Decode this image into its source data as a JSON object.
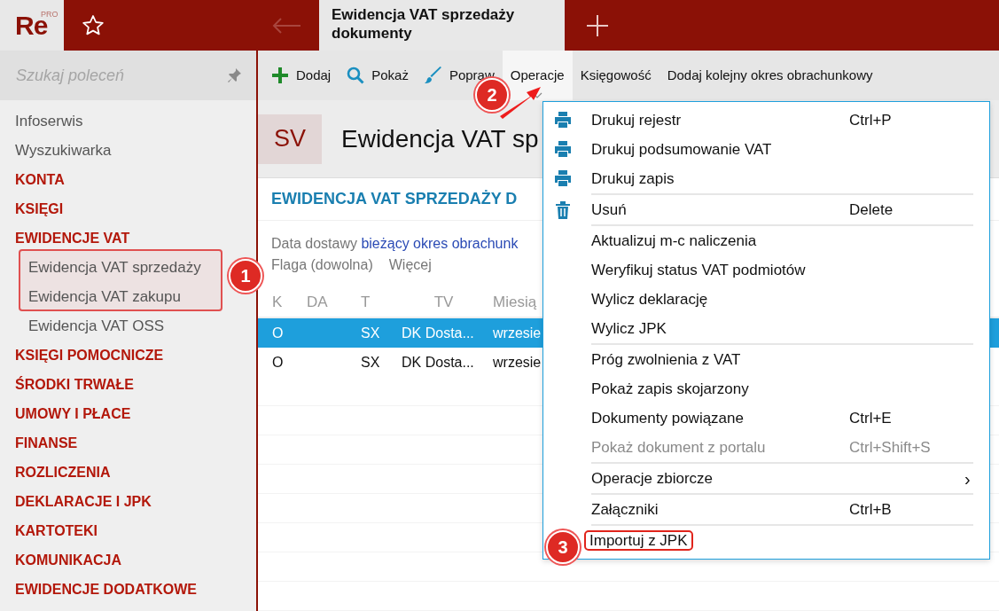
{
  "app": {
    "logo": "Re",
    "logo_badge": "PRO"
  },
  "tabs": [
    {
      "label": "Ewidencja VAT sprzedaży dokumenty",
      "selected": true
    }
  ],
  "sidebar": {
    "search": {
      "placeholder": "Szukaj poleceń"
    },
    "items": [
      {
        "label": "Infoserwis",
        "kind": "link"
      },
      {
        "label": "Wyszukiwarka",
        "kind": "link"
      },
      {
        "label": "KONTA",
        "kind": "section"
      },
      {
        "label": "KSIĘGI",
        "kind": "section"
      },
      {
        "label": "EWIDENCJE VAT",
        "kind": "section"
      },
      {
        "label": "Ewidencja VAT sprzedaży",
        "kind": "sub"
      },
      {
        "label": "Ewidencja VAT zakupu",
        "kind": "sub"
      },
      {
        "label": "Ewidencja VAT OSS",
        "kind": "sub"
      },
      {
        "label": "KSIĘGI POMOCNICZE",
        "kind": "section"
      },
      {
        "label": "ŚRODKI TRWAŁE",
        "kind": "section"
      },
      {
        "label": "UMOWY I PŁACE",
        "kind": "section"
      },
      {
        "label": "FINANSE",
        "kind": "section"
      },
      {
        "label": "ROZLICZENIA",
        "kind": "section"
      },
      {
        "label": "DEKLARACJE I JPK",
        "kind": "section"
      },
      {
        "label": "KARTOTEKI",
        "kind": "section"
      },
      {
        "label": "KOMUNIKACJA",
        "kind": "section"
      },
      {
        "label": "EWIDENCJE DODATKOWE",
        "kind": "section"
      }
    ]
  },
  "toolbar": [
    {
      "label": "Dodaj",
      "kind": "add",
      "selected": false
    },
    {
      "label": "Pokaż",
      "kind": "search",
      "selected": false
    },
    {
      "label": "Popraw",
      "kind": "edit",
      "selected": false
    },
    {
      "label": "Operacje",
      "kind": "plain",
      "selected": true
    },
    {
      "label": "Księgowość",
      "kind": "plain",
      "selected": false
    },
    {
      "label": "Dodaj kolejny okres obrachunkowy",
      "kind": "plain",
      "selected": false
    }
  ],
  "header": {
    "code": "SV",
    "title": "Ewidencja VAT sp"
  },
  "card": {
    "title": "EWIDENCJA VAT SPRZEDAŻY D",
    "filter_label": "Data dostawy",
    "filter_value": "bieżący okres obrachunk",
    "flag": "Flaga (dowolna)",
    "more": "Więcej"
  },
  "table": {
    "columns": [
      "K",
      "DA",
      "T",
      "TV",
      "Miesią"
    ],
    "rows": [
      {
        "cells": [
          "O",
          "",
          "SX",
          "DK Dosta...",
          "wrzesie"
        ],
        "selected": true
      },
      {
        "cells": [
          "O",
          "",
          "SX",
          "DK Dosta...",
          "wrzesie"
        ],
        "selected": false
      }
    ]
  },
  "menu": {
    "groups": [
      [
        {
          "label": "Drukuj rejestr",
          "shortcut": "Ctrl+P",
          "kind": "print",
          "disabled": false
        },
        {
          "label": "Drukuj podsumowanie VAT",
          "kind": "print",
          "disabled": false
        },
        {
          "label": "Drukuj zapis",
          "kind": "print",
          "disabled": false
        }
      ],
      [
        {
          "label": "Usuń",
          "shortcut": "Delete",
          "kind": "delete",
          "disabled": false
        }
      ],
      [
        {
          "label": "Aktualizuj m-c naliczenia",
          "kind": "plain",
          "disabled": false
        },
        {
          "label": "Weryfikuj status VAT podmiotów",
          "kind": "plain",
          "disabled": false
        },
        {
          "label": "Wylicz deklarację",
          "kind": "plain",
          "disabled": false
        },
        {
          "label": "Wylicz JPK",
          "kind": "plain",
          "disabled": false
        }
      ],
      [
        {
          "label": "Próg zwolnienia z VAT",
          "kind": "plain",
          "disabled": false
        },
        {
          "label": "Pokaż zapis skojarzony",
          "kind": "plain",
          "disabled": false
        },
        {
          "label": "Dokumenty powiązane",
          "shortcut": "Ctrl+E",
          "kind": "plain",
          "disabled": false
        },
        {
          "label": "Pokaż dokument z portalu",
          "shortcut": "Ctrl+Shift+S",
          "kind": "plain",
          "disabled": true
        }
      ],
      [
        {
          "label": "Operacje zbiorcze",
          "submenu": "›",
          "kind": "plain",
          "disabled": false
        }
      ],
      [
        {
          "label": "Załączniki",
          "shortcut": "Ctrl+B",
          "kind": "plain",
          "disabled": false
        }
      ],
      [
        {
          "label": "Importuj z JPK",
          "kind": "plain",
          "disabled": false,
          "highlighted": true
        }
      ]
    ]
  },
  "callouts": [
    "1",
    "2",
    "3"
  ]
}
